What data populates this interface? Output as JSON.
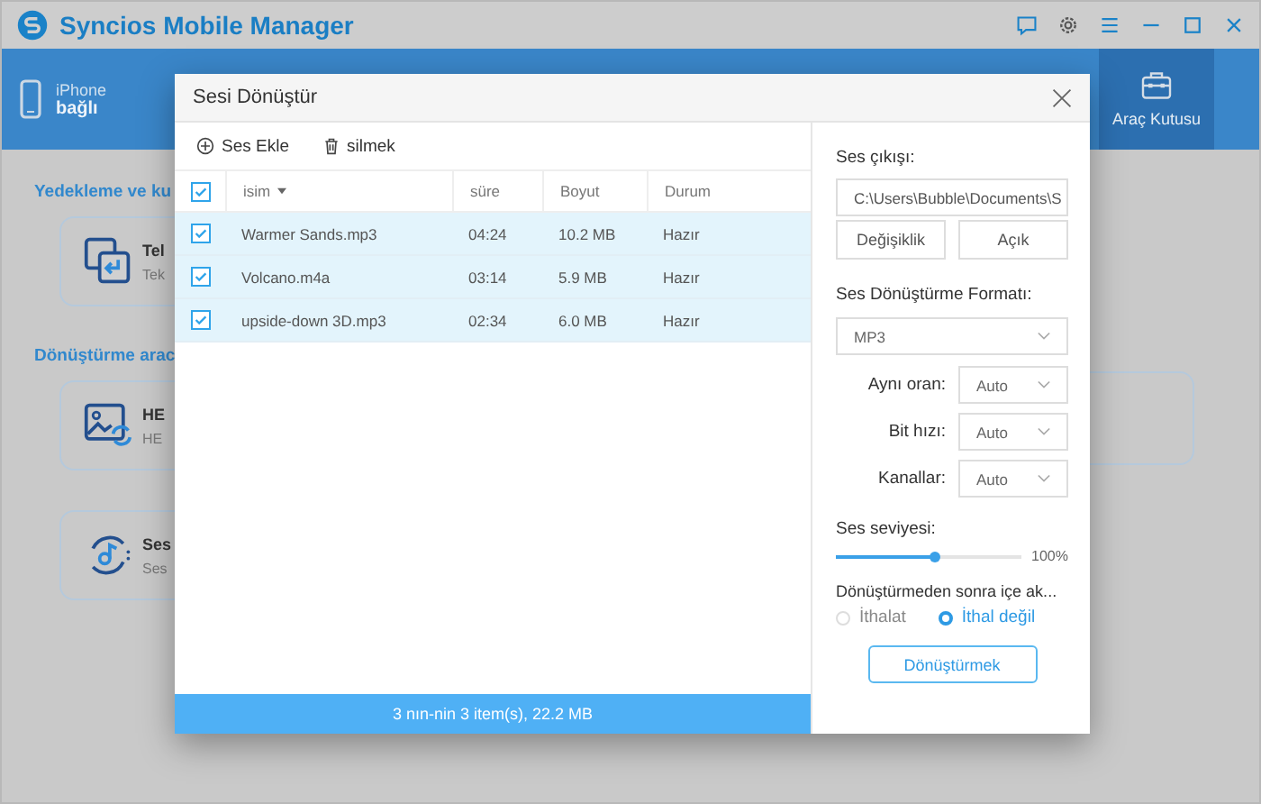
{
  "app": {
    "title": "Syncios Mobile Manager"
  },
  "device": {
    "name": "iPhone",
    "status": "bağlı"
  },
  "toolbar_tabs": [
    {
      "label": "Araç Kutusu",
      "selected": true
    }
  ],
  "sections": [
    {
      "heading": "Yedekleme ve ku",
      "cards": [
        {
          "title": "Tel",
          "subtitle": "Tek",
          "kind": "transfer"
        }
      ]
    },
    {
      "heading": "Dönüştürme arac",
      "cards": [
        {
          "title": "HE",
          "subtitle": "HE",
          "kind": "image"
        },
        {
          "title": "Ses",
          "subtitle": "Ses",
          "kind": "audio"
        }
      ]
    }
  ],
  "dialog": {
    "title": "Sesi Dönüştür",
    "actions": [
      {
        "label": "Ses Ekle",
        "kind": "add"
      },
      {
        "label": "silmek",
        "kind": "delete"
      }
    ],
    "table": {
      "all_checked": true,
      "columns": [
        {
          "label": "isim",
          "sorted": true
        },
        {
          "label": "süre",
          "sorted": false
        },
        {
          "label": "Boyut",
          "sorted": false
        },
        {
          "label": "Durum",
          "sorted": false
        }
      ],
      "rows": [
        {
          "checked": true,
          "cells": [
            "Warmer Sands.mp3",
            "04:24",
            "10.2 MB",
            "Hazır"
          ]
        },
        {
          "checked": true,
          "cells": [
            "Volcano.m4a",
            "03:14",
            "5.9 MB",
            "Hazır"
          ]
        },
        {
          "checked": true,
          "cells": [
            "upside-down 3D.mp3",
            "02:34",
            "6.0 MB",
            "Hazır"
          ]
        }
      ]
    },
    "footer": "3 nın-nin 3 item(s), 22.2 MB",
    "output_label": "Ses çıkışı:",
    "output_path": "C:\\Users\\Bubble\\Documents\\S",
    "path_buttons": [
      "Değişiklik",
      "Açık"
    ],
    "format_label": "Ses Dönüştürme Formatı:",
    "format": "MP3",
    "options": [
      {
        "label": "Aynı oran:",
        "value": "Auto"
      },
      {
        "label": "Bit hızı:",
        "value": "Auto"
      },
      {
        "label": "Kanallar:",
        "value": "Auto"
      }
    ],
    "volume_label": "Ses seviyesi:",
    "volume": {
      "level": 1.0,
      "reading": "100%"
    },
    "after_label": "Dönüştürmeden sonra içe ak...",
    "after_options": [
      {
        "label": "İthalat",
        "selected": false
      },
      {
        "label": "İthal değil",
        "selected": true
      }
    ],
    "convert_button": "Dönüştürmek"
  }
}
